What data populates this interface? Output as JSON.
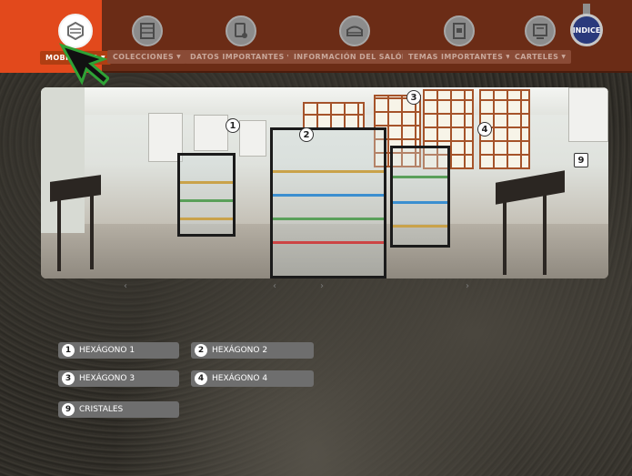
{
  "nav": {
    "items": [
      {
        "label": "MOBILIARIO",
        "icon": "hexagon-cabinet-icon",
        "active": true
      },
      {
        "label": "COLECCIONES",
        "icon": "shelf-icon",
        "active": false
      },
      {
        "label": "DATOS IMPORTANTES",
        "icon": "touch-screen-icon",
        "active": false
      },
      {
        "label": "INFORMACIÓN DEL SALÓN",
        "icon": "room-icon",
        "active": false
      },
      {
        "label": "TEMAS IMPORTANTES",
        "icon": "document-icon",
        "active": false
      },
      {
        "label": "CARTELES",
        "icon": "poster-icon",
        "active": false
      }
    ],
    "indice_label": "INDICE"
  },
  "panorama": {
    "hotspots": [
      "1",
      "2",
      "3",
      "4",
      "9"
    ],
    "scroll_arrows": [
      "‹",
      "‹",
      "›",
      "›"
    ]
  },
  "hotspot_buttons": [
    {
      "num": "1",
      "label": "HEXÁGONO 1"
    },
    {
      "num": "2",
      "label": "HEXÁGONO 2"
    },
    {
      "num": "3",
      "label": "HEXÁGONO 3"
    },
    {
      "num": "4",
      "label": "HEXÁGONO 4"
    },
    {
      "num": "9",
      "label": "CRISTALES"
    }
  ],
  "colors": {
    "topbar": "#6b2c16",
    "active_tab": "#e2491c",
    "button_bg": "#6e6e6e",
    "indice": "#2a3a7c"
  }
}
